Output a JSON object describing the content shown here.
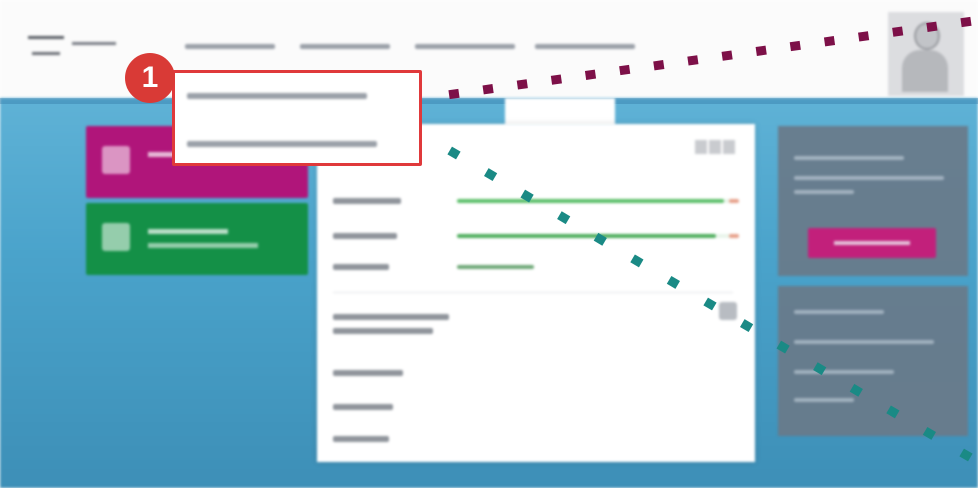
{
  "nav": {
    "links": [
      "",
      "",
      "",
      ""
    ]
  },
  "callout": {
    "badge": "1",
    "items": [
      "",
      ""
    ]
  },
  "colors": {
    "callout_red": "#e0393b",
    "badge_red": "#d93a36",
    "tile_pink": "#b0157a",
    "tile_green": "#149047",
    "button_pink": "#cc1575",
    "dots_purple": "#7d1048",
    "dots_teal": "#1a8a85",
    "bar_green": "#5cbf6a"
  },
  "icons": {
    "logo": "app-logo",
    "avatar": "user-avatar-icon",
    "settings": "settings-icon",
    "tile_pink": "tile-icon",
    "tile_green": "tile-icon"
  },
  "usage_bars": [
    {
      "fraction": 0.97
    },
    {
      "fraction": 0.94
    },
    {
      "fraction": 0.28
    }
  ]
}
